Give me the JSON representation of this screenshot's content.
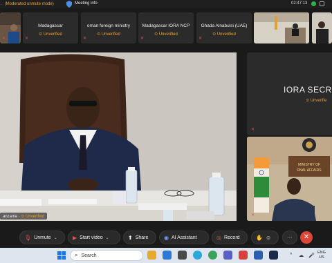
{
  "topbar": {
    "mode_prefix": ".",
    "mode_label": "(Moderated unmute mode)",
    "meeting_info": "Meeting info",
    "clock": "02:47:13"
  },
  "strip": {
    "tiles": [
      {
        "name": "Madagascar",
        "status": "Unverified"
      },
      {
        "name": "oman foreign ministry",
        "status": "Unverified"
      },
      {
        "name": "Madagascar IORA NCP",
        "status": "Unverified"
      },
      {
        "name": "Ghada Alnabulsi (UAE)",
        "status": "Unverified"
      }
    ]
  },
  "main": {
    "speaker_name": "anzania",
    "speaker_status": "Unverified"
  },
  "right": {
    "tile1_name": "IORA SECRET",
    "tile1_status": "Unverifie"
  },
  "controls": {
    "unmute": "Unmute",
    "start_video": "Start video",
    "share": "Share",
    "ai_assistant": "AI Assistant",
    "record": "Record",
    "more": "···"
  },
  "taskbar": {
    "search_placeholder": "Search",
    "lang": "ENG",
    "region": "US"
  },
  "colors": {
    "unverified": "#f0a030",
    "end_button": "#e0453a",
    "status_green": "#2eb34b"
  }
}
